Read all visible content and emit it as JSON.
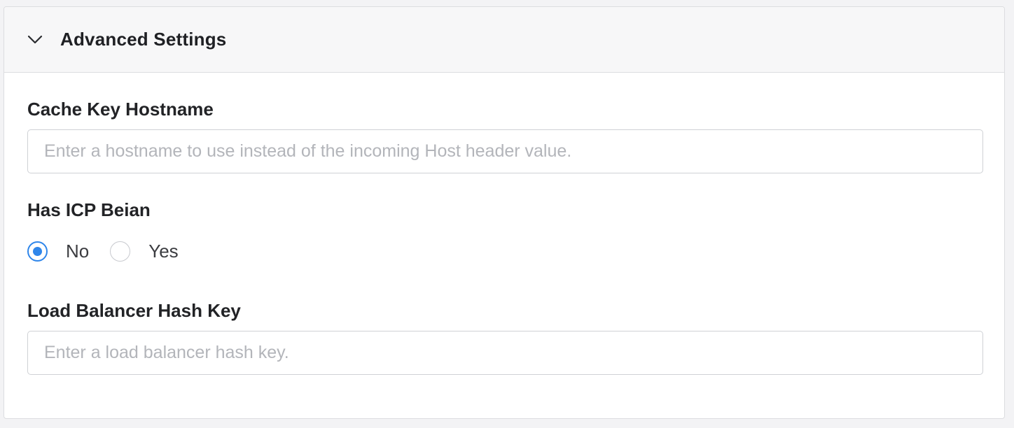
{
  "panel": {
    "title": "Advanced Settings",
    "expanded": true,
    "chevron_icon": "chevron-down-icon"
  },
  "fields": {
    "cache_key_hostname": {
      "label": "Cache Key Hostname",
      "value": "",
      "placeholder": "Enter a hostname to use instead of the incoming Host header value."
    },
    "has_icp_beian": {
      "label": "Has ICP Beian",
      "options": [
        {
          "label": "No",
          "checked": true
        },
        {
          "label": "Yes",
          "checked": false
        }
      ],
      "selected": "No"
    },
    "load_balancer_hash_key": {
      "label": "Load Balancer Hash Key",
      "value": "",
      "placeholder": "Enter a load balancer hash key."
    }
  },
  "colors": {
    "accent": "#2f86ea",
    "border": "#dcdde0",
    "header_bg": "#f7f7f8",
    "placeholder": "#b3b5ba",
    "text": "#222326"
  }
}
